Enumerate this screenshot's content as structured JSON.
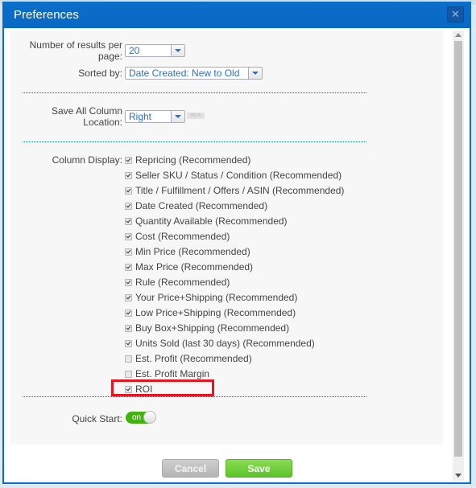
{
  "dialog": {
    "title": "Preferences",
    "close_icon": "close-icon"
  },
  "results_per_page": {
    "label_line1": "Number of results per",
    "label_line2": "page:",
    "value": "20"
  },
  "sorted_by": {
    "label": "Sorted by:",
    "value": "Date Created: New to Old"
  },
  "save_all_column_location": {
    "label_line1": "Save All Column",
    "label_line2": "Location:",
    "value": "Right",
    "badge": "BETA"
  },
  "column_display": {
    "label": "Column Display:",
    "items": [
      {
        "label": "Repricing (Recommended)",
        "checked": true
      },
      {
        "label": "Seller SKU / Status / Condition (Recommended)",
        "checked": true
      },
      {
        "label": "Title / Fulfillment / Offers / ASIN (Recommended)",
        "checked": true
      },
      {
        "label": "Date Created (Recommended)",
        "checked": true
      },
      {
        "label": "Quantity Available (Recommended)",
        "checked": true
      },
      {
        "label": "Cost (Recommended)",
        "checked": true
      },
      {
        "label": "Min Price (Recommended)",
        "checked": true
      },
      {
        "label": "Max Price (Recommended)",
        "checked": true
      },
      {
        "label": "Rule (Recommended)",
        "checked": true
      },
      {
        "label": "Your Price+Shipping (Recommended)",
        "checked": true
      },
      {
        "label": "Low Price+Shipping (Recommended)",
        "checked": true
      },
      {
        "label": "Buy Box+Shipping (Recommended)",
        "checked": true
      },
      {
        "label": "Units Sold (last 30 days) (Recommended)",
        "checked": true
      },
      {
        "label": "Est. Profit (Recommended)",
        "checked": false
      },
      {
        "label": "Est. Profit Margin",
        "checked": false
      },
      {
        "label": "ROI",
        "checked": true
      }
    ]
  },
  "quick_start": {
    "label": "Quick Start:",
    "state": "on"
  },
  "buttons": {
    "cancel": "Cancel",
    "save": "Save"
  },
  "colors": {
    "titlebar": "#0b6ec9",
    "highlight": "#e8141f",
    "toggle_on": "#44b312",
    "save_button": "#5cc22a"
  }
}
